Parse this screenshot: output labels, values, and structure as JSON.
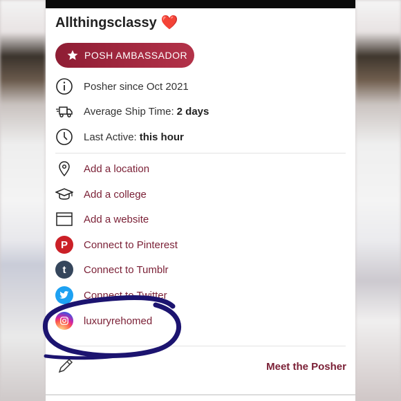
{
  "profile": {
    "username": "Allthingsclassy",
    "heart_emoji": "❤️",
    "badge_label": "POSH AMBASSADOR"
  },
  "stats": {
    "posher_since": "Posher since Oct 2021",
    "ship_time_label": "Average Ship Time:",
    "ship_time_value": "2 days",
    "last_active_label": "Last Active:",
    "last_active_value": "this hour"
  },
  "links": {
    "location": "Add a location",
    "college": "Add a college",
    "website": "Add a website",
    "pinterest": "Connect to Pinterest",
    "tumblr": "Connect to Tumblr",
    "twitter": "Connect to Twitter",
    "instagram": "luxuryrehomed"
  },
  "footer": {
    "meet_label": "Meet the Posher"
  },
  "colors": {
    "brand": "#7a1f35",
    "badge_gradient_start": "#8e1d34",
    "badge_gradient_end": "#b33249",
    "pinterest": "#cb2027",
    "tumblr": "#35465c",
    "twitter": "#1da1f2",
    "scribble": "#1c1470"
  },
  "icons": {
    "badge": "star-icon",
    "posher_since": "info-icon",
    "ship_time": "truck-icon",
    "last_active": "clock-icon",
    "location": "map-pin-icon",
    "college": "graduation-cap-icon",
    "website": "browser-window-icon",
    "pinterest": "pinterest-icon",
    "tumblr": "tumblr-icon",
    "twitter": "twitter-icon",
    "instagram": "instagram-icon",
    "edit": "pencil-icon"
  }
}
